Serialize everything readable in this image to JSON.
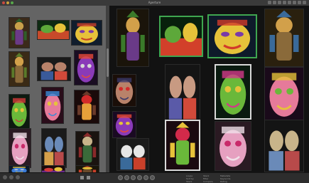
{
  "window": {
    "title": "Aperture",
    "close_color": "#c94a40",
    "minimize_color": "#caa23c",
    "zoom_color": "#58a84a"
  },
  "statusbar": {
    "group1": [
      "Loupe",
      "Sort by",
      "Stack"
    ],
    "group2": [
      "Stack",
      "Filter",
      "Compare"
    ],
    "group3": [
      "Metadata",
      "Keywords",
      "Rating"
    ]
  },
  "thumbnails": {
    "left": [
      {
        "name": "jester-figure",
        "palette": [
          "#3b2a1a",
          "#c8a04a",
          "#6b3a88",
          "#2f5d2a"
        ],
        "motif": "figure"
      },
      {
        "name": "float-scene-green",
        "palette": [
          "#0e2a12",
          "#5da83a",
          "#c84a2a",
          "#e6c23a"
        ],
        "motif": "wide"
      },
      {
        "name": "mask-face-yellow",
        "palette": [
          "#101d2d",
          "#e6c23a",
          "#7a3aa8",
          "#c8402a"
        ],
        "motif": "face"
      },
      {
        "name": "king-figure-gold",
        "palette": [
          "#3a2a16",
          "#d2a04a",
          "#8a6a3a",
          "#5a7a2a"
        ],
        "motif": "figure"
      },
      {
        "name": "two-heads",
        "palette": [
          "#1a1a1a",
          "#b8826a",
          "#3a5a9a",
          "#d24a3a"
        ],
        "motif": "pair"
      },
      {
        "name": "devil-mask-purple",
        "palette": [
          "#1a0d22",
          "#8a3ab8",
          "#d6d6d6",
          "#e64a3a"
        ],
        "motif": "face"
      },
      {
        "name": "clown-face-green",
        "palette": [
          "#0d1a10",
          "#6ab83a",
          "#e6c23a",
          "#d23a3a"
        ],
        "motif": "face"
      },
      {
        "name": "sun-mask-pink",
        "palette": [
          "#2a0d1a",
          "#e67a9a",
          "#e6c23a",
          "#3a8ad6"
        ],
        "motif": "face"
      },
      {
        "name": "red-dragon",
        "palette": [
          "#1a0a0a",
          "#d22a2a",
          "#e6a03a",
          "#6a3a2a"
        ],
        "motif": "figure"
      },
      {
        "name": "pink-face-heart",
        "palette": [
          "#2a1a22",
          "#e6a0c0",
          "#c82a6a",
          "#f0e0e8"
        ],
        "motif": "face"
      },
      {
        "name": "crowd-figures",
        "palette": [
          "#1a1a1a",
          "#6a8ab8",
          "#d6a04a",
          "#b84a4a"
        ],
        "motif": "pair"
      },
      {
        "name": "horned-figure",
        "palette": [
          "#1a1410",
          "#c8b48a",
          "#3a6a3a",
          "#8a2a2a"
        ],
        "motif": "figure"
      },
      {
        "name": "blue-mask-small",
        "palette": [
          "#0d1a2a",
          "#3a7ad6",
          "#d6d6d6",
          "#e6c23a"
        ],
        "motif": "face"
      },
      {
        "name": "red-float-small",
        "palette": [
          "#1a0a0a",
          "#d23a3a",
          "#6a2a8a",
          "#e6c23a"
        ],
        "motif": "wide"
      },
      {
        "name": "yellow-hat",
        "palette": [
          "#1a160a",
          "#e6c23a",
          "#6a4a2a",
          "#c8402a"
        ],
        "motif": "figure"
      }
    ],
    "main": [
      {
        "name": "jester-statue-large",
        "palette": [
          "#1a140a",
          "#d2a04a",
          "#6a3a88",
          "#3a7a2a"
        ],
        "motif": "figure"
      },
      {
        "name": "float-scene-wide",
        "palette": [
          "#08200c",
          "#5da83a",
          "#d2402a",
          "#e6c23a"
        ],
        "motif": "wide"
      },
      {
        "name": "mask-face-gold",
        "palette": [
          "#0e1a2a",
          "#e6c23a",
          "#7a3aa8",
          "#d23a2a"
        ],
        "motif": "face"
      },
      {
        "name": "king-statue-large",
        "palette": [
          "#2a200e",
          "#d2a04a",
          "#8a6a3a",
          "#3a6a9a"
        ],
        "motif": "figure"
      },
      {
        "name": "tiki-head-red",
        "palette": [
          "#1a0e08",
          "#b8826a",
          "#d22a2a",
          "#3a3a6a"
        ],
        "motif": "face"
      },
      {
        "name": "two-busts",
        "palette": [
          "#141414",
          "#c89a82",
          "#5a5aa8",
          "#d24a3a"
        ],
        "motif": "pair"
      },
      {
        "name": "sun-mask-green",
        "palette": [
          "#0a1a10",
          "#6ab83a",
          "#e6c23a",
          "#d23a8a"
        ],
        "motif": "face"
      },
      {
        "name": "clown-face-large",
        "palette": [
          "#1a0a1a",
          "#e67a9a",
          "#6ab83a",
          "#e6c23a"
        ],
        "motif": "face"
      },
      {
        "name": "devil-mask-large",
        "palette": [
          "#1a0a22",
          "#8a3ab8",
          "#e6c23a",
          "#e64a3a"
        ],
        "motif": "face"
      },
      {
        "name": "dragon-float",
        "palette": [
          "#1a0a10",
          "#d22a4a",
          "#6ab83a",
          "#e6c23a"
        ],
        "motif": "figure"
      },
      {
        "name": "pink-heart-face",
        "palette": [
          "#2a1a22",
          "#e6a0c0",
          "#c82a6a",
          "#f0e0e8"
        ],
        "motif": "face"
      },
      {
        "name": "crowd-clowns",
        "palette": [
          "#141414",
          "#c8b48a",
          "#6a8ab8",
          "#b84a4a"
        ],
        "motif": "pair"
      },
      {
        "name": "white-figures",
        "palette": [
          "#1a1a1a",
          "#e6e6e6",
          "#3a6a9a",
          "#c8402a"
        ],
        "motif": "pair"
      }
    ]
  }
}
